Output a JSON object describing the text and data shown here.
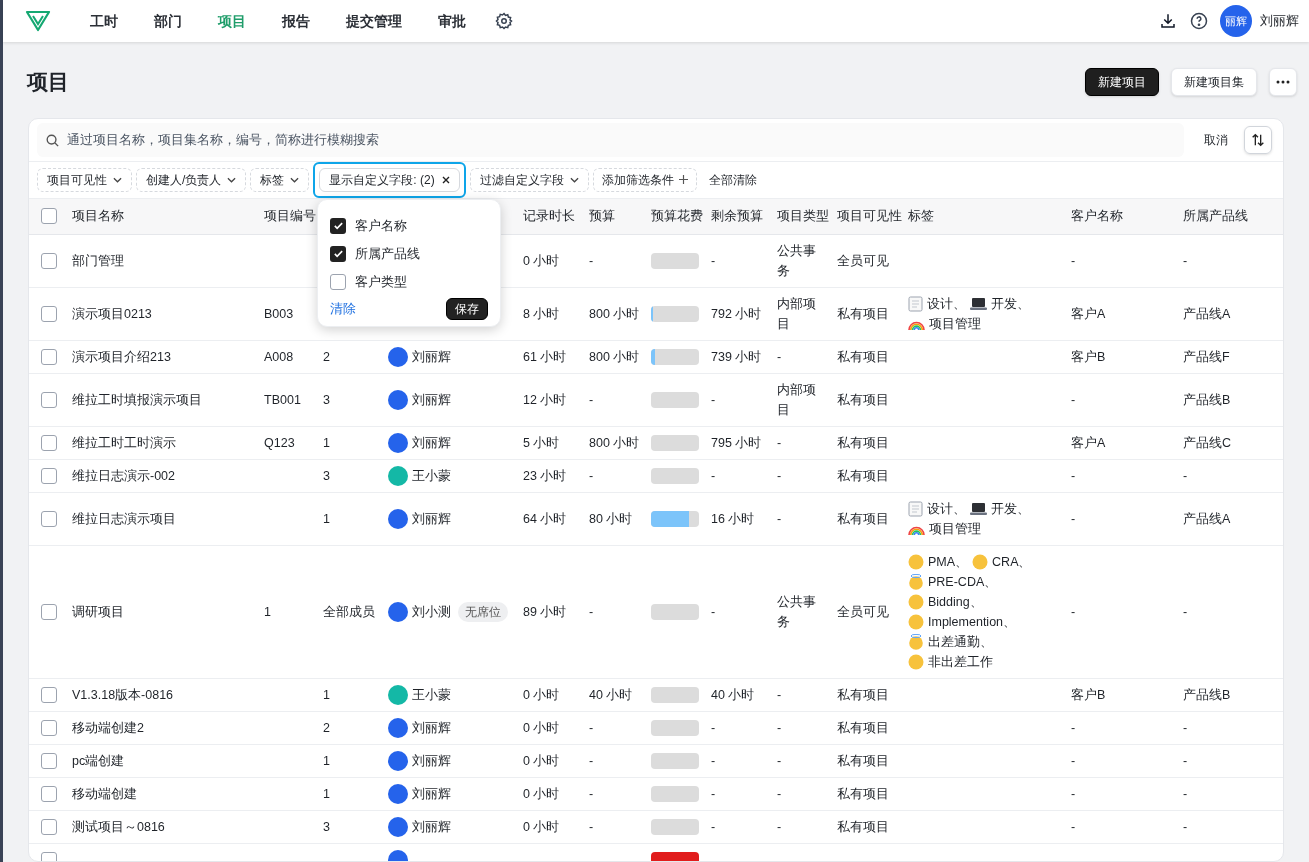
{
  "nav": {
    "items": [
      {
        "label": "工时",
        "selected": false
      },
      {
        "label": "部门",
        "selected": false
      },
      {
        "label": "项目",
        "selected": true
      },
      {
        "label": "报告",
        "selected": false
      },
      {
        "label": "提交管理",
        "selected": false
      },
      {
        "label": "审批",
        "selected": false
      }
    ],
    "user": {
      "avatar_text": "丽辉",
      "name": "刘丽辉"
    }
  },
  "page": {
    "title": "项目",
    "actions": [
      {
        "label": "新建项目",
        "kind": "primary"
      },
      {
        "label": "新建项目集",
        "kind": "secondary"
      }
    ]
  },
  "search": {
    "placeholder": "通过项目名称，项目集名称，编号，简称进行模糊搜索",
    "cancel": "取消"
  },
  "filters": [
    {
      "label": "项目可见性",
      "kind": "dropdown",
      "focused": false
    },
    {
      "label": "创建人/负责人",
      "kind": "dropdown",
      "focused": false
    },
    {
      "label": "标签",
      "kind": "dropdown",
      "focused": false
    },
    {
      "label": "显示自定义字段: (2)",
      "kind": "removable",
      "focused": true
    },
    {
      "label": "过滤自定义字段",
      "kind": "dropdown",
      "focused": false
    },
    {
      "label": "添加筛选条件",
      "kind": "add",
      "focused": false
    },
    {
      "label": "全部清除",
      "kind": "text",
      "focused": false
    }
  ],
  "dropdown": {
    "options": [
      {
        "label": "客户名称",
        "checked": true
      },
      {
        "label": "所属产品线",
        "checked": true
      },
      {
        "label": "客户类型",
        "checked": false
      }
    ],
    "clear": "清除",
    "save": "保存"
  },
  "table": {
    "select_all": {
      "checked": false
    },
    "columns": [
      "项目名称",
      "项目编号",
      "记录时长",
      "预算",
      "预算花费",
      "剩余预算",
      "项目类型",
      "项目可见性",
      "标签",
      "客户名称",
      "所属产品线"
    ],
    "rows": [
      {
        "checked": false,
        "name": "部门管理",
        "hours": "0 小时",
        "budget": "-",
        "spend": {
          "level": 0
        },
        "remaining": "-",
        "type": "公共事务",
        "visibility": "全员可见",
        "customer": "-",
        "product_line": "-"
      },
      {
        "checked": false,
        "name": "演示项目0213",
        "code": "B003",
        "hours": "8 小时",
        "budget": "800 小时",
        "spend": {
          "level": 0.01
        },
        "remaining": "792 小时",
        "type": "内部项目",
        "visibility": "私有项目",
        "tags": [
          {
            "kind": "note",
            "label": "设计、"
          },
          {
            "kind": "laptop",
            "label": "开发、"
          },
          {
            "kind": "rainbow",
            "label": "项目管理"
          }
        ],
        "customer": "客户A",
        "product_line": "产品线A"
      },
      {
        "checked": false,
        "name": "演示项目介绍213",
        "code": "A008",
        "members": "2",
        "owner": {
          "color": "#2563eb",
          "name": "刘丽辉"
        },
        "hours": "61 小时",
        "budget": "800 小时",
        "spend": {
          "level": 0.08
        },
        "remaining": "739 小时",
        "type": "-",
        "visibility": "私有项目",
        "customer": "客户B",
        "product_line": "产品线F"
      },
      {
        "checked": false,
        "name": "维拉工时填报演示项目",
        "code": "TB001",
        "members": "3",
        "owner": {
          "color": "#2563eb",
          "name": "刘丽辉"
        },
        "hours": "12 小时",
        "budget": "-",
        "spend": {
          "level": 0
        },
        "remaining": "-",
        "type": "内部项目",
        "visibility": "私有项目",
        "customer": "-",
        "product_line": "产品线B"
      },
      {
        "checked": false,
        "name": "维拉工时工时演示",
        "code": "Q123",
        "members": "1",
        "owner": {
          "color": "#2563eb",
          "name": "刘丽辉"
        },
        "hours": "5 小时",
        "budget": "800 小时",
        "spend": {
          "level": 0
        },
        "remaining": "795 小时",
        "type": "-",
        "visibility": "私有项目",
        "customer": "客户A",
        "product_line": "产品线C"
      },
      {
        "checked": false,
        "name": "维拉日志演示-002",
        "members": "3",
        "owner": {
          "color": "#14b8a6",
          "name": "王小蒙"
        },
        "hours": "23 小时",
        "budget": "-",
        "spend": {
          "level": 0
        },
        "remaining": "-",
        "type": "-",
        "visibility": "私有项目",
        "customer": "-",
        "product_line": "-"
      },
      {
        "checked": false,
        "name": "维拉日志演示项目",
        "members": "1",
        "owner": {
          "color": "#2563eb",
          "name": "刘丽辉"
        },
        "hours": "64 小时",
        "budget": "80 小时",
        "spend": {
          "level": 0.8
        },
        "remaining": "16 小时",
        "type": "-",
        "visibility": "私有项目",
        "tags": [
          {
            "kind": "note",
            "label": "设计、"
          },
          {
            "kind": "laptop",
            "label": "开发、"
          },
          {
            "kind": "rainbow",
            "label": "项目管理"
          }
        ],
        "customer": "-",
        "product_line": "产品线A"
      },
      {
        "checked": false,
        "name": "调研项目",
        "code": "1",
        "members": "全部成员",
        "owner": {
          "color": "#2563eb",
          "name": "刘小测",
          "badge": "无席位"
        },
        "hours": "89 小时",
        "budget": "-",
        "spend": {
          "level": 0
        },
        "remaining": "-",
        "type": "公共事务",
        "visibility": "全员可见",
        "tags": [
          {
            "kind": "face",
            "label": "PMA、"
          },
          {
            "kind": "face",
            "label": "CRA、"
          },
          {
            "kind": "halo",
            "label": "PRE-CDA、"
          },
          {
            "kind": "face",
            "label": "Bidding、"
          },
          {
            "kind": "face",
            "label": "Implemention、"
          },
          {
            "kind": "halo",
            "label": "出差通勤、"
          },
          {
            "kind": "face",
            "label": "非出差工作"
          }
        ],
        "customer": "-",
        "product_line": "-"
      },
      {
        "checked": false,
        "name": "V1.3.18版本-0816",
        "members": "1",
        "owner": {
          "color": "#14b8a6",
          "name": "王小蒙"
        },
        "hours": "0 小时",
        "budget": "40 小时",
        "spend": {
          "level": 0
        },
        "remaining": "40 小时",
        "type": "-",
        "visibility": "私有项目",
        "customer": "客户B",
        "product_line": "产品线B"
      },
      {
        "checked": false,
        "name": "移动端创建2",
        "members": "2",
        "owner": {
          "color": "#2563eb",
          "name": "刘丽辉"
        },
        "hours": "0 小时",
        "budget": "-",
        "spend": {
          "level": 0
        },
        "remaining": "-",
        "type": "-",
        "visibility": "私有项目",
        "customer": "-",
        "product_line": "-"
      },
      {
        "checked": false,
        "name": "pc端创建",
        "members": "1",
        "owner": {
          "color": "#2563eb",
          "name": "刘丽辉"
        },
        "hours": "0 小时",
        "budget": "-",
        "spend": {
          "level": 0
        },
        "remaining": "-",
        "type": "-",
        "visibility": "私有项目",
        "customer": "-",
        "product_line": "-"
      },
      {
        "checked": false,
        "name": "移动端创建",
        "members": "1",
        "owner": {
          "color": "#2563eb",
          "name": "刘丽辉"
        },
        "hours": "0 小时",
        "budget": "-",
        "spend": {
          "level": 0
        },
        "remaining": "-",
        "type": "-",
        "visibility": "私有项目",
        "customer": "-",
        "product_line": "-"
      },
      {
        "checked": false,
        "name": "测试项目～0816",
        "members": "3",
        "owner": {
          "color": "#2563eb",
          "name": "刘丽辉"
        },
        "hours": "0 小时",
        "budget": "-",
        "spend": {
          "level": 0
        },
        "remaining": "-",
        "type": "-",
        "visibility": "私有项目",
        "customer": "-",
        "product_line": "-"
      },
      {
        "checked": false,
        "owner": {
          "color": "#2563eb"
        },
        "spend": {
          "level": 1,
          "over": true
        }
      }
    ]
  }
}
